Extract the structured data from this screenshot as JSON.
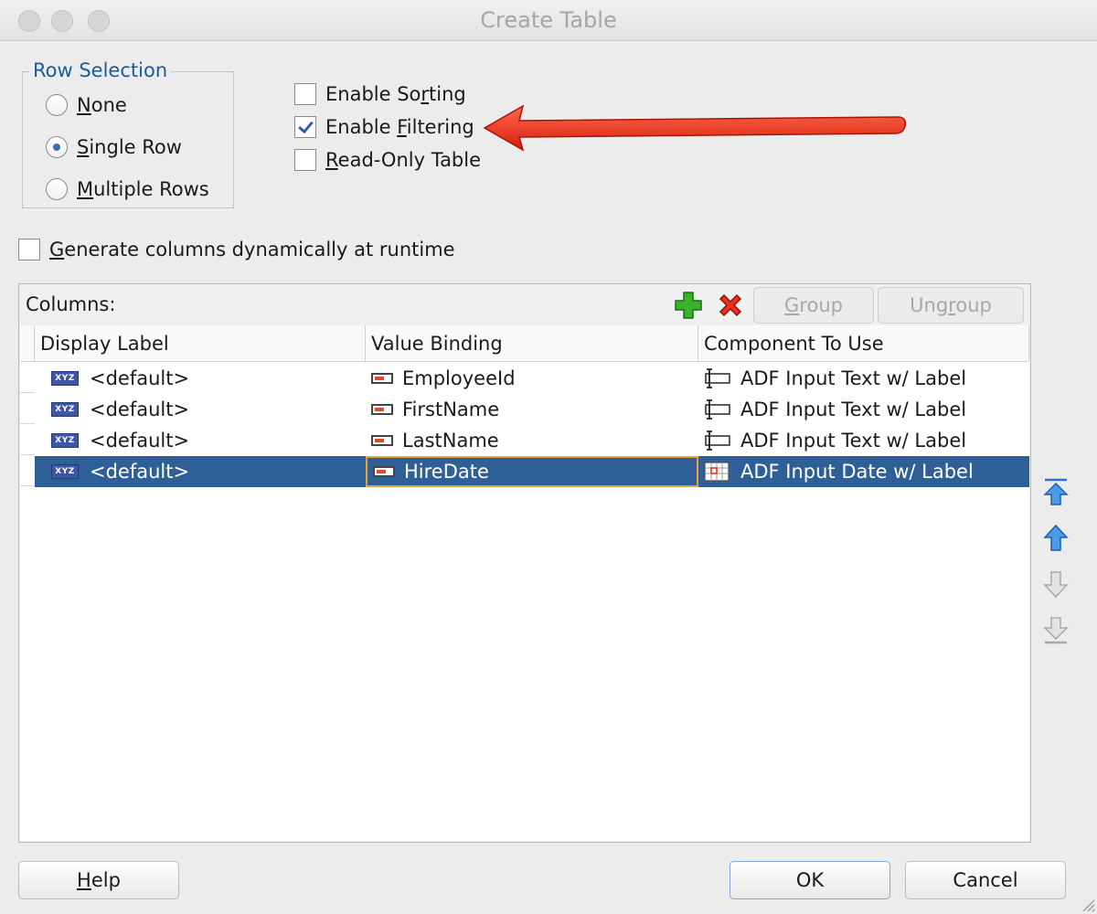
{
  "window": {
    "title": "Create Table"
  },
  "row_selection": {
    "legend": "Row Selection",
    "options": [
      {
        "label": "None",
        "mnemonic": "N",
        "rest": "one",
        "checked": false
      },
      {
        "label": "Single Row",
        "mnemonic": "S",
        "rest": "ingle Row",
        "checked": true
      },
      {
        "label": "Multiple Rows",
        "mnemonic": "M",
        "rest": "ultiple Rows",
        "checked": false
      }
    ]
  },
  "options": {
    "sorting": {
      "pre": "Enable So",
      "mnemonic": "r",
      "post": "ting",
      "checked": false
    },
    "filtering": {
      "pre": "Enable ",
      "mnemonic": "F",
      "post": "iltering",
      "checked": true
    },
    "readonly": {
      "pre": "",
      "mnemonic": "R",
      "post": "ead-Only Table",
      "checked": false
    }
  },
  "generate_columns": {
    "pre": "",
    "mnemonic": "G",
    "post": "enerate columns dynamically at runtime",
    "checked": false
  },
  "columns": {
    "label": "Columns:",
    "group_pre": "",
    "group_mn": "G",
    "group_post": "roup",
    "ungroup_pre": "Ung",
    "ungroup_mn": "r",
    "ungroup_post": "oup",
    "headers": {
      "display": "Display Label",
      "value": "Value Binding",
      "component": "Component To Use"
    },
    "rows": [
      {
        "display": "<default>",
        "value": "EmployeeId",
        "component": "ADF Input Text w/ Label"
      },
      {
        "display": "<default>",
        "value": "FirstName",
        "component": "ADF Input Text w/ Label"
      },
      {
        "display": "<default>",
        "value": "LastName",
        "component": "ADF Input Text w/ Label"
      },
      {
        "display": "<default>",
        "value": "HireDate",
        "component": "ADF Input Date w/ Label"
      }
    ]
  },
  "icons": {
    "xyz": "XYZ"
  },
  "buttons": {
    "help_mn": "H",
    "help_post": "elp",
    "ok": "OK",
    "cancel": "Cancel"
  },
  "colors": {
    "accent": "#2f5f97",
    "annotation_arrow": "#e8321e"
  }
}
